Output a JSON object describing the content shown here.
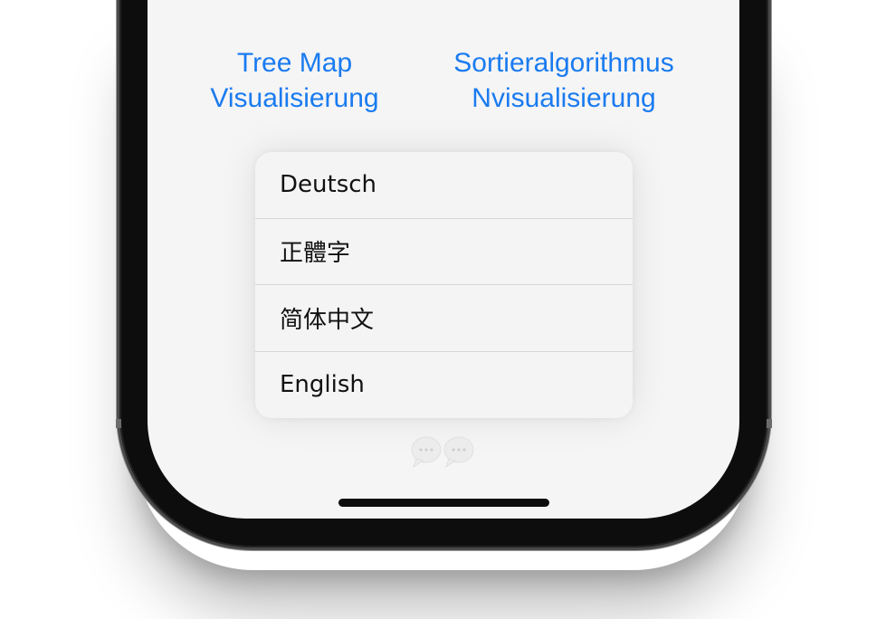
{
  "links": {
    "treemap": "Tree Map\nVisualisierung",
    "sorting": "Sortieralgorithmus\nNvisualisierung"
  },
  "language_menu": {
    "items": [
      {
        "label": "Deutsch"
      },
      {
        "label": "正體字"
      },
      {
        "label": "简体中文"
      },
      {
        "label": "English"
      }
    ]
  },
  "icons": {
    "bubbles": "chat-bubbles-icon"
  },
  "colors": {
    "accent": "#1a7bf0",
    "screen_background": "#f5f5f5",
    "menu_background": "#f4f4f4",
    "bezel": "#0d0d0d"
  }
}
